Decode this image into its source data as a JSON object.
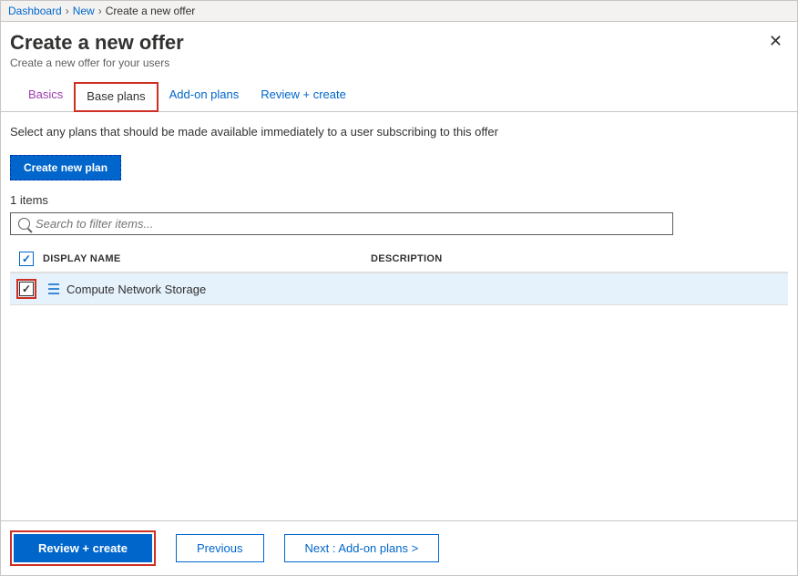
{
  "breadcrumb": {
    "items": [
      "Dashboard",
      "New",
      "Create a new offer"
    ]
  },
  "header": {
    "title": "Create a new offer",
    "subtitle": "Create a new offer for your users"
  },
  "tabs": [
    {
      "label": "Basics"
    },
    {
      "label": "Base plans"
    },
    {
      "label": "Add-on plans"
    },
    {
      "label": "Review + create"
    }
  ],
  "content": {
    "description": "Select any plans that should be made available immediately to a user subscribing to this offer",
    "create_plan_label": "Create new plan",
    "items_count": "1 items",
    "search_placeholder": "Search to filter items...",
    "columns": {
      "name": "DISPLAY NAME",
      "description": "DESCRIPTION"
    },
    "rows": [
      {
        "name": "Compute Network Storage",
        "description": "",
        "checked": true
      }
    ]
  },
  "footer": {
    "review_label": "Review + create",
    "previous_label": "Previous",
    "next_label": "Next : Add-on plans >"
  }
}
